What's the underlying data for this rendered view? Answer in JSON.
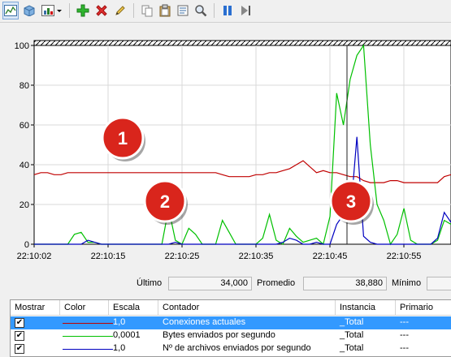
{
  "toolbar": {
    "buttons": [
      {
        "name": "view-graph-button",
        "icon": "graph-icon"
      },
      {
        "name": "view-histogram-button",
        "icon": "histogram-icon"
      },
      {
        "name": "change-graph-type-button",
        "icon": "report-icon"
      },
      {
        "name": "add-counter-button",
        "icon": "plus-icon"
      },
      {
        "name": "delete-counter-button",
        "icon": "x-icon"
      },
      {
        "name": "highlight-button",
        "icon": "pencil-icon"
      },
      {
        "name": "copy-properties-button",
        "icon": "copy-icon"
      },
      {
        "name": "paste-counter-list-button",
        "icon": "paste-icon"
      },
      {
        "name": "properties-button",
        "icon": "properties-icon"
      },
      {
        "name": "zoom-button",
        "icon": "magnifier-icon"
      },
      {
        "name": "freeze-display-button",
        "icon": "pause-icon"
      },
      {
        "name": "update-data-button",
        "icon": "step-icon"
      }
    ]
  },
  "chart_data": {
    "type": "line",
    "title": "",
    "xlabel": "",
    "ylabel": "",
    "ylim": [
      0,
      100
    ],
    "yticks": [
      "100",
      "80",
      "60",
      "40",
      "20",
      "0"
    ],
    "xticks": [
      "22:10:02",
      "22:10:15",
      "22:10:25",
      "22:10:35",
      "22:10:45",
      "22:10:55"
    ],
    "grid": true,
    "callouts": [
      "1",
      "2",
      "3"
    ],
    "series": [
      {
        "name": "Conexiones actuales",
        "color": "#c00000",
        "values": [
          35,
          36,
          36,
          35,
          35,
          36,
          36,
          36,
          36,
          36,
          36,
          36,
          36,
          36,
          36,
          36,
          36,
          36,
          36,
          36,
          36,
          36,
          36,
          36,
          36,
          36,
          36,
          36,
          35,
          34,
          34,
          34,
          34,
          35,
          35,
          36,
          36,
          37,
          38,
          40,
          42,
          39,
          36,
          37,
          36,
          36,
          35,
          34,
          34,
          32,
          31,
          31,
          31,
          32,
          32,
          31,
          31,
          31,
          31,
          31,
          31,
          34,
          35
        ]
      },
      {
        "name": "Bytes enviados por segundo",
        "color": "#00c000",
        "values": [
          0,
          0,
          0,
          0,
          0,
          0,
          5,
          6,
          1,
          1,
          0,
          0,
          0,
          0,
          0,
          0,
          0,
          0,
          0,
          0,
          18,
          2,
          0,
          8,
          5,
          0,
          0,
          0,
          12,
          6,
          0,
          0,
          0,
          0,
          3,
          15,
          2,
          0,
          8,
          4,
          1,
          2,
          3,
          0,
          14,
          76,
          60,
          83,
          95,
          100,
          50,
          20,
          12,
          0,
          5,
          18,
          2,
          0,
          0,
          0,
          2,
          12,
          10
        ]
      },
      {
        "name": "Nº de archivos enviados por segundo",
        "color": "#0000c0",
        "values": [
          0,
          0,
          0,
          0,
          0,
          0,
          0,
          0,
          2,
          1,
          0,
          0,
          0,
          0,
          0,
          0,
          0,
          0,
          0,
          0,
          0,
          1,
          0,
          0,
          0,
          0,
          0,
          0,
          0,
          0,
          0,
          0,
          0,
          0,
          0,
          0,
          0,
          1,
          3,
          2,
          0,
          0,
          1,
          0,
          0,
          10,
          15,
          13,
          54,
          4,
          1,
          0,
          0,
          0,
          0,
          0,
          0,
          0,
          0,
          0,
          3,
          16,
          11
        ]
      }
    ]
  },
  "stats": {
    "last_label": "Último",
    "last_value": "34,000",
    "avg_label": "Promedio",
    "avg_value": "38,880",
    "min_label": "Mínimo"
  },
  "table": {
    "headers": [
      "Mostrar",
      "Color",
      "Escala",
      "Contador",
      "Instancia",
      "Primario"
    ],
    "rows": [
      {
        "checked": "✔",
        "color": "#c00000",
        "scale": "1,0",
        "counter": "Conexiones actuales",
        "instance": "_Total",
        "parent": "---",
        "selected": true
      },
      {
        "checked": "✔",
        "color": "#00c000",
        "scale": "0,0001",
        "counter": "Bytes enviados por segundo",
        "instance": "_Total",
        "parent": "---",
        "selected": false
      },
      {
        "checked": "✔",
        "color": "#0000c0",
        "scale": "1,0",
        "counter": "Nº de archivos enviados por segundo",
        "instance": "_Total",
        "parent": "---",
        "selected": false
      }
    ]
  }
}
